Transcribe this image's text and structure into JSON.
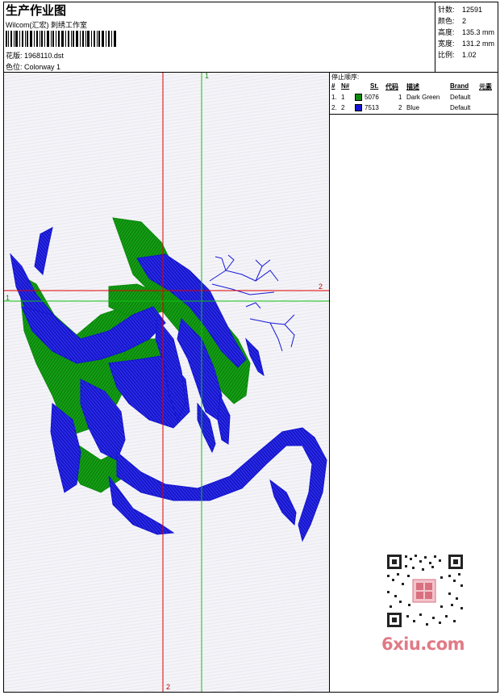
{
  "header": {
    "title": "生产作业图",
    "subtitle": "Wilcom(汇宏) 刺绣工作室",
    "design_label": "花版:",
    "design_value": "1968110.dst",
    "colorway_label": "色位:",
    "colorway_value": "Colorway 1"
  },
  "stats": [
    {
      "label": "针数:",
      "value": "12591"
    },
    {
      "label": "颜色:",
      "value": "2"
    },
    {
      "label": "高度:",
      "value": "135.3 mm"
    },
    {
      "label": "宽度:",
      "value": "131.2 mm"
    },
    {
      "label": "比例:",
      "value": "1.02"
    }
  ],
  "stop_sequence": {
    "title": "停止顺序:",
    "headers": {
      "index": "#",
      "no": "N#",
      "st": "St.",
      "code": "代码",
      "desc": "描述",
      "brand": "Brand",
      "element": "元素"
    },
    "rows": [
      {
        "index": "1.",
        "no": "1",
        "color": "#0d8a0d",
        "st": "5076",
        "code": "1",
        "desc": "Dark Green",
        "brand": "Default"
      },
      {
        "index": "2.",
        "no": "2",
        "color": "#1414d2",
        "st": "7513",
        "code": "2",
        "desc": "Blue",
        "brand": "Default"
      }
    ]
  },
  "axes": {
    "green_top": "1",
    "green_left": "1",
    "red_right": "2",
    "red_bottom": "2"
  },
  "watermark": "6xiu.com"
}
